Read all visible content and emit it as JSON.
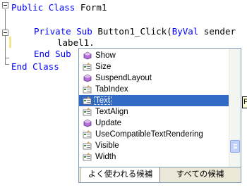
{
  "editor": {
    "lines": {
      "l1": {
        "kw1": "Public",
        "kw2": "Class",
        "name": "Form1"
      },
      "l2": {
        "kw1": "Private",
        "kw2": "Sub",
        "name": "Button1_Click(",
        "kw3": "ByVal",
        "rest": " sender"
      },
      "l3": {
        "text": "label1."
      },
      "l4": {
        "kw1": "End",
        "kw2": "Sub"
      },
      "l5": {
        "kw1": "End",
        "kw2": "Class"
      }
    }
  },
  "intellisense": {
    "items": [
      {
        "label": "Show",
        "icon": "method-icon",
        "selected": false
      },
      {
        "label": "Size",
        "icon": "property-icon",
        "selected": false
      },
      {
        "label": "SuspendLayout",
        "icon": "method-icon",
        "selected": false
      },
      {
        "label": "TabIndex",
        "icon": "property-icon",
        "selected": false
      },
      {
        "label": "Text",
        "icon": "property-icon",
        "selected": true
      },
      {
        "label": "TextAlign",
        "icon": "property-icon",
        "selected": false
      },
      {
        "label": "Update",
        "icon": "method-icon",
        "selected": false
      },
      {
        "label": "UseCompatibleTextRendering",
        "icon": "property-icon",
        "selected": false
      },
      {
        "label": "Visible",
        "icon": "property-icon",
        "selected": false
      },
      {
        "label": "Width",
        "icon": "property-icon",
        "selected": false
      }
    ],
    "tabs": {
      "common": "よく使われる候補",
      "all": "すべての候補"
    },
    "selection_color": "#316ac5"
  },
  "tooltip": {
    "text": "P"
  }
}
